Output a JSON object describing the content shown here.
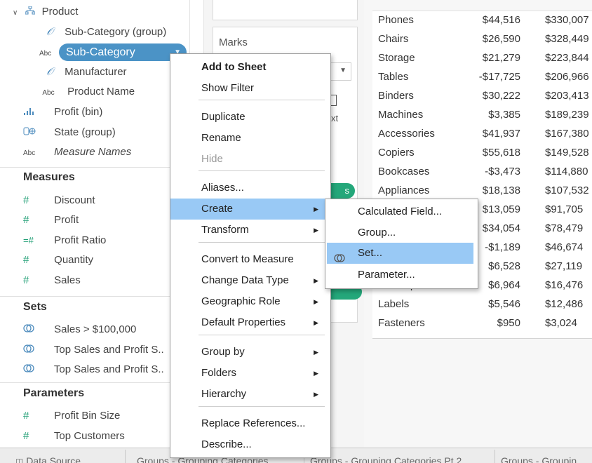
{
  "data_pane": {
    "dimensions": {
      "items": [
        {
          "label": "Product",
          "icon": "hierarchy-icon"
        },
        {
          "label": "Sub-Category (group)",
          "icon": "paperclip-icon"
        },
        {
          "label": "Sub-Category",
          "icon": "abc-icon",
          "type_label": "Abc",
          "selected": true
        },
        {
          "label": "Manufacturer",
          "icon": "paperclip-icon"
        },
        {
          "label": "Product Name",
          "icon": "abc-icon",
          "type_label": "Abc"
        },
        {
          "label": "Profit (bin)",
          "icon": "histogram-icon"
        },
        {
          "label": "State (group)",
          "icon": "group-icon"
        },
        {
          "label": "Measure Names",
          "icon": "abc-icon",
          "type_label": "Abc"
        }
      ]
    },
    "measures": {
      "header": "Measures",
      "items": [
        {
          "label": "Discount",
          "icon": "hash-icon"
        },
        {
          "label": "Profit",
          "icon": "hash-icon"
        },
        {
          "label": "Profit Ratio",
          "icon": "calc-hash-icon"
        },
        {
          "label": "Quantity",
          "icon": "hash-icon"
        },
        {
          "label": "Sales",
          "icon": "hash-icon"
        }
      ]
    },
    "sets": {
      "header": "Sets",
      "items": [
        {
          "label": "Sales > $100,000",
          "icon": "set-icon"
        },
        {
          "label": "Top Sales and Profit S..",
          "icon": "set-icon"
        },
        {
          "label": "Top Sales and Profit S..",
          "icon": "set-icon"
        }
      ]
    },
    "parameters": {
      "header": "Parameters",
      "items": [
        {
          "label": "Profit Bin Size",
          "icon": "hash-icon"
        },
        {
          "label": "Top Customers",
          "icon": "hash-icon"
        }
      ]
    }
  },
  "cards": {
    "marks_title": "Marks",
    "fragment_text": "xt",
    "green_pill_text": "s"
  },
  "table": {
    "rows": [
      {
        "category": "Phones",
        "profit": "$44,516",
        "sales": "$330,007"
      },
      {
        "category": "Chairs",
        "profit": "$26,590",
        "sales": "$328,449"
      },
      {
        "category": "Storage",
        "profit": "$21,279",
        "sales": "$223,844"
      },
      {
        "category": "Tables",
        "profit": "-$17,725",
        "sales": "$206,966"
      },
      {
        "category": "Binders",
        "profit": "$30,222",
        "sales": "$203,413"
      },
      {
        "category": "Machines",
        "profit": "$3,385",
        "sales": "$189,239"
      },
      {
        "category": "Accessories",
        "profit": "$41,937",
        "sales": "$167,380"
      },
      {
        "category": "Copiers",
        "profit": "$55,618",
        "sales": "$149,528"
      },
      {
        "category": "Bookcases",
        "profit": "-$3,473",
        "sales": "$114,880"
      },
      {
        "category": "Appliances",
        "profit": "$18,138",
        "sales": "$107,532"
      },
      {
        "category": "",
        "profit": "$13,059",
        "sales": "$91,705"
      },
      {
        "category": "",
        "profit": "$34,054",
        "sales": "$78,479"
      },
      {
        "category": "",
        "profit": "-$1,189",
        "sales": "$46,674"
      },
      {
        "category": "",
        "profit": "$6,528",
        "sales": "$27,119"
      },
      {
        "category": "Envelopes",
        "profit": "$6,964",
        "sales": "$16,476"
      },
      {
        "category": "Labels",
        "profit": "$5,546",
        "sales": "$12,486"
      },
      {
        "category": "Fasteners",
        "profit": "$950",
        "sales": "$3,024"
      }
    ]
  },
  "context_menu": {
    "items": [
      {
        "label": "Add to Sheet",
        "bold": true
      },
      {
        "label": "Show Filter"
      },
      {
        "label": "Duplicate"
      },
      {
        "label": "Rename"
      },
      {
        "label": "Hide",
        "disabled": true
      },
      {
        "label": "Aliases..."
      },
      {
        "label": "Create",
        "submenu": true,
        "highlighted": true
      },
      {
        "label": "Transform",
        "submenu": true
      },
      {
        "label": "Convert to Measure"
      },
      {
        "label": "Change Data Type",
        "submenu": true
      },
      {
        "label": "Geographic Role",
        "submenu": true
      },
      {
        "label": "Default Properties",
        "submenu": true
      },
      {
        "label": "Group by",
        "submenu": true
      },
      {
        "label": "Folders",
        "submenu": true
      },
      {
        "label": "Hierarchy",
        "submenu": true
      },
      {
        "label": "Replace References..."
      },
      {
        "label": "Describe..."
      }
    ]
  },
  "create_submenu": {
    "items": [
      {
        "label": "Calculated Field..."
      },
      {
        "label": "Group..."
      },
      {
        "label": "Set...",
        "highlighted": true,
        "icon": "set-icon"
      },
      {
        "label": "Parameter..."
      }
    ]
  },
  "tabs": {
    "data_source": "Data Source",
    "sheets": [
      "Groups - Grouping Categories",
      "Groups - Grouping Categories Pt 2",
      "Groups - Groupin"
    ]
  },
  "colors": {
    "selected_pill": "#4b93c6",
    "menu_highlight": "#99c9f5",
    "measure_green": "#1f9e74",
    "dimension_blue": "#4c8bbd"
  }
}
